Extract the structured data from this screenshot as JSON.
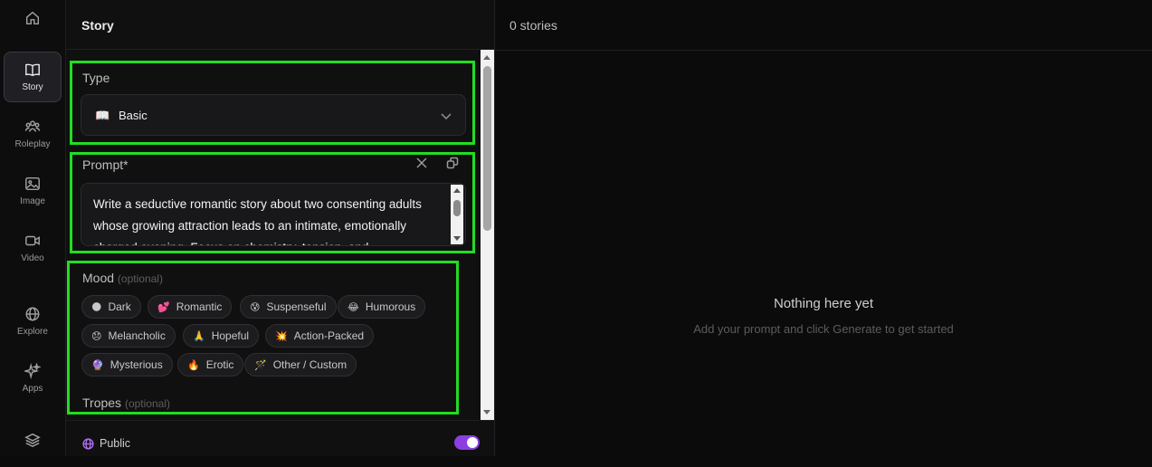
{
  "nav": {
    "items": [
      {
        "label": "",
        "icon": "home-icon"
      },
      {
        "label": "Story",
        "icon": "book-icon"
      },
      {
        "label": "Roleplay",
        "icon": "people-icon"
      },
      {
        "label": "Image",
        "icon": "image-icon"
      },
      {
        "label": "Video",
        "icon": "video-icon"
      },
      {
        "label": "Explore",
        "icon": "globe-icon"
      },
      {
        "label": "Apps",
        "icon": "sparkles-icon"
      },
      {
        "label": "",
        "icon": "layers-icon"
      }
    ]
  },
  "panel": {
    "title": "Story",
    "type": {
      "label": "Type",
      "value": "Basic",
      "emoji": "📖"
    },
    "prompt": {
      "label": "Prompt*",
      "value": "Write a seductive romantic story about two consenting adults whose growing attraction leads to an intimate, emotionally charged evening. Focus on chemistry, tension, and"
    },
    "mood": {
      "label": "Mood",
      "optional": "(optional)",
      "chips": [
        {
          "emoji": "🌑",
          "label": "Dark"
        },
        {
          "emoji": "💕",
          "label": "Romantic"
        },
        {
          "emoji": "😰",
          "label": "Suspenseful"
        },
        {
          "emoji": "😂",
          "label": "Humorous"
        },
        {
          "emoji": "😞",
          "label": "Melancholic"
        },
        {
          "emoji": "🙏",
          "label": "Hopeful"
        },
        {
          "emoji": "💥",
          "label": "Action-Packed"
        },
        {
          "emoji": "🔮",
          "label": "Mysterious"
        },
        {
          "emoji": "🔥",
          "label": "Erotic"
        },
        {
          "emoji": "🪄",
          "label": "Other / Custom"
        }
      ]
    },
    "tropes": {
      "label": "Tropes",
      "optional": "(optional)"
    },
    "footer": {
      "visibility": "Public",
      "toggle_on": true,
      "accent": "#8b3fe0"
    }
  },
  "results": {
    "count": "0 stories",
    "empty_title": "Nothing here yet",
    "empty_subtitle": "Add your prompt and click Generate to get started"
  }
}
